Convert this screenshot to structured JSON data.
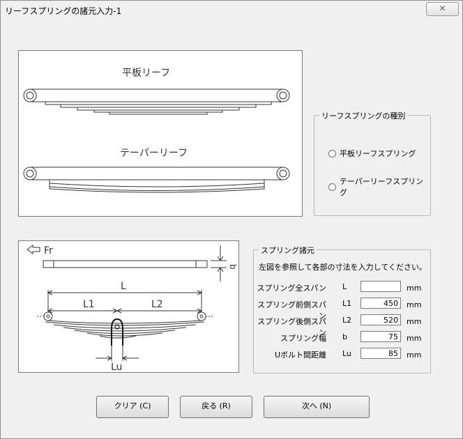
{
  "window": {
    "title": "リーフスプリングの諸元入力-1",
    "close_label": "✕"
  },
  "diagram_top": {
    "flat_label": "平板リーフ",
    "taper_label": "テーパーリーフ"
  },
  "spring_type": {
    "legend": "リーフスプリングの種別",
    "options": [
      {
        "label": "平板リーフスプリング",
        "selected": false
      },
      {
        "label": "テーパーリーフスプリング",
        "selected": false
      }
    ]
  },
  "diagram_bottom": {
    "fr_label": "Fr",
    "b_label": "b",
    "L_label": "L",
    "L1_label": "L1",
    "L2_label": "L2",
    "Lu_label": "Lu"
  },
  "specs": {
    "legend": "スプリング諸元",
    "instruction": "左図を参照して各部の寸法を入力してください。",
    "unit": "mm",
    "rows": [
      {
        "label": "スプリング全スパン",
        "symbol": "L",
        "value": ""
      },
      {
        "label": "スプリング前側スパン",
        "symbol": "L1",
        "value": "450"
      },
      {
        "label": "スプリング後側スパン",
        "symbol": "L2",
        "value": "520"
      },
      {
        "label": "スプリング幅",
        "symbol": "b",
        "value": "75"
      },
      {
        "label": "Uボルト間距離",
        "symbol": "Lu",
        "value": "85"
      }
    ]
  },
  "buttons": {
    "clear": "クリア (C)",
    "back": "戻る (R)",
    "next": "次へ (N)"
  }
}
